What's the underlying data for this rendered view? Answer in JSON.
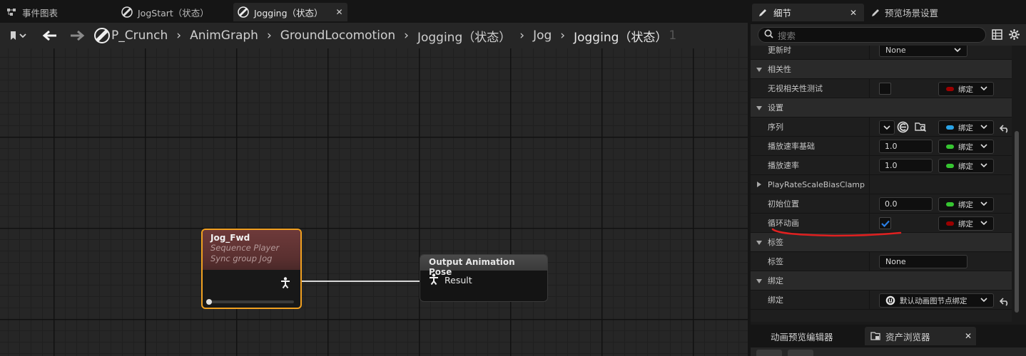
{
  "graph_editor": {
    "tabs": [
      {
        "label": "事件图表",
        "icon": "event-graph-icon"
      },
      {
        "label": "JogStart（状态）",
        "icon": "state-icon"
      },
      {
        "label": "Jogging（状态）",
        "icon": "state-icon",
        "active": true
      }
    ],
    "breadcrumbs": [
      "P_Crunch",
      "AnimGraph",
      "GroundLocomotion",
      "Jogging（状态）",
      "Jog",
      "Jogging（状态）"
    ],
    "breadcrumb_overflow": "1",
    "nodes": {
      "jog_fwd": {
        "title": "Jog_Fwd",
        "subtitle": "Sequence Player",
        "sync_group": "Sync group Jog",
        "progress": 0
      },
      "output_pose": {
        "title": "Output Animation Pose",
        "result_label": "Result"
      }
    }
  },
  "details_panel": {
    "tabs": [
      {
        "label": "细节",
        "icon": "details-icon",
        "active": true
      },
      {
        "label": "预览场景设置",
        "icon": "preview-scene-icon"
      }
    ],
    "search_placeholder": "搜索",
    "rows": {
      "update_partial_label": "更新时",
      "update_partial_value": "None",
      "cat_relevancy": "相关性",
      "ignore_relevancy_label": "无视相关性测试",
      "cat_settings": "设置",
      "sequence_label": "序列",
      "play_rate_basis_label": "播放速率基础",
      "play_rate_basis_value": "1.0",
      "play_rate_label": "播放速率",
      "play_rate_value": "1.0",
      "play_rate_clamp_label": "PlayRateScaleBiasClamp",
      "start_position_label": "初始位置",
      "start_position_value": "0.0",
      "loop_label": "循环动画",
      "loop_checked": true,
      "cat_tag": "标签",
      "tag_label": "标签",
      "tag_value": "None",
      "cat_binding": "绑定",
      "binding_label": "绑定",
      "binding_value": "默认动画图节点绑定"
    },
    "bind_label": "绑定",
    "colors": {
      "bool_pin": "#9b0000",
      "object_pin": "#2aa3e6",
      "float_pin": "#36c531",
      "accent_check": "#2a7fe6",
      "selected_border": "#f0a020",
      "annotation": "#e02020"
    },
    "bottom_tabs": [
      {
        "label": "动画预览编辑器"
      },
      {
        "label": "资产浏览器",
        "icon": "asset-browser-icon",
        "active": true
      }
    ]
  }
}
